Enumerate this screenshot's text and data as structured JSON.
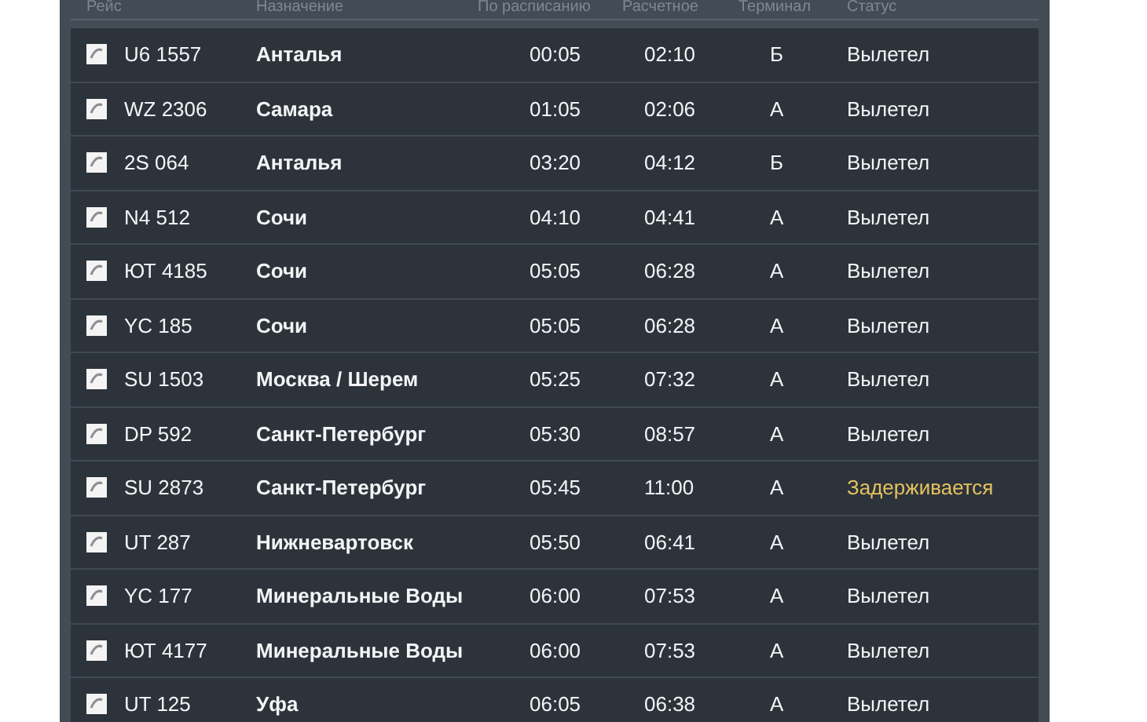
{
  "columns": [
    "Рейс",
    "Назначение",
    "По расписанию",
    "Расчетное",
    "Терминал",
    "Статус"
  ],
  "rows": [
    {
      "flight": "U6 1557",
      "destination": "Анталья",
      "scheduled": "00:05",
      "estimated": "02:10",
      "terminal": "Б",
      "status": "Вылетел",
      "color": "#f2f4f6"
    },
    {
      "flight": "WZ 2306",
      "destination": "Самара",
      "scheduled": "01:05",
      "estimated": "02:06",
      "terminal": "А",
      "status": "Вылетел",
      "color": "#f2f4f6"
    },
    {
      "flight": "2S 064",
      "destination": "Анталья",
      "scheduled": "03:20",
      "estimated": "04:12",
      "terminal": "Б",
      "status": "Вылетел",
      "color": "#f2f4f6"
    },
    {
      "flight": "N4 512",
      "destination": "Сочи",
      "scheduled": "04:10",
      "estimated": "04:41",
      "terminal": "А",
      "status": "Вылетел",
      "color": "#f2f4f6"
    },
    {
      "flight": "ЮТ 4185",
      "destination": "Сочи",
      "scheduled": "05:05",
      "estimated": "06:28",
      "terminal": "А",
      "status": "Вылетел",
      "color": "#f2f4f6"
    },
    {
      "flight": "YC 185",
      "destination": "Сочи",
      "scheduled": "05:05",
      "estimated": "06:28",
      "terminal": "А",
      "status": "Вылетел",
      "color": "#f2f4f6"
    },
    {
      "flight": "SU 1503",
      "destination": "Москва / Шерем",
      "scheduled": "05:25",
      "estimated": "07:32",
      "terminal": "А",
      "status": "Вылетел",
      "color": "#f2f4f6"
    },
    {
      "flight": "DP 592",
      "destination": "Санкт-Петербург",
      "scheduled": "05:30",
      "estimated": "08:57",
      "terminal": "А",
      "status": "Вылетел",
      "color": "#f2f4f6"
    },
    {
      "flight": "SU 2873",
      "destination": "Санкт-Петербург",
      "scheduled": "05:45",
      "estimated": "11:00",
      "terminal": "А",
      "status": "Задерживается",
      "color": "#e5c25e"
    },
    {
      "flight": "UT 287",
      "destination": "Нижневартовск",
      "scheduled": "05:50",
      "estimated": "06:41",
      "terminal": "А",
      "status": "Вылетел",
      "color": "#f2f4f6"
    },
    {
      "flight": "YC 177",
      "destination": "Минеральные Воды",
      "scheduled": "06:00",
      "estimated": "07:53",
      "terminal": "А",
      "status": "Вылетел",
      "color": "#f2f4f6"
    },
    {
      "flight": "ЮТ 4177",
      "destination": "Минеральные Воды",
      "scheduled": "06:00",
      "estimated": "07:53",
      "terminal": "А",
      "status": "Вылетел",
      "color": "#f2f4f6"
    },
    {
      "flight": "UT 125",
      "destination": "Уфа",
      "scheduled": "06:05",
      "estimated": "06:38",
      "terminal": "А",
      "status": "Вылетел",
      "color": "#f2f4f6"
    }
  ]
}
